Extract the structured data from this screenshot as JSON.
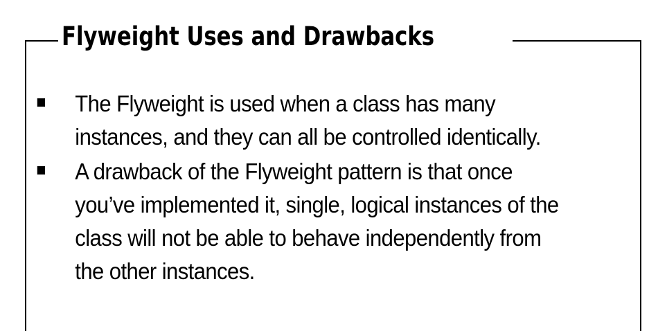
{
  "slide": {
    "title": "Flyweight Uses and Drawbacks",
    "bullets": [
      {
        "lines": [
          "The Flyweight is used when a class has many",
          "instances, and they can all be controlled identically."
        ]
      },
      {
        "lines": [
          "A drawback of the Flyweight pattern is that once",
          "you’ve implemented it, single, logical instances of the",
          "class will not be able to behave independently from",
          "the other instances."
        ]
      }
    ]
  }
}
